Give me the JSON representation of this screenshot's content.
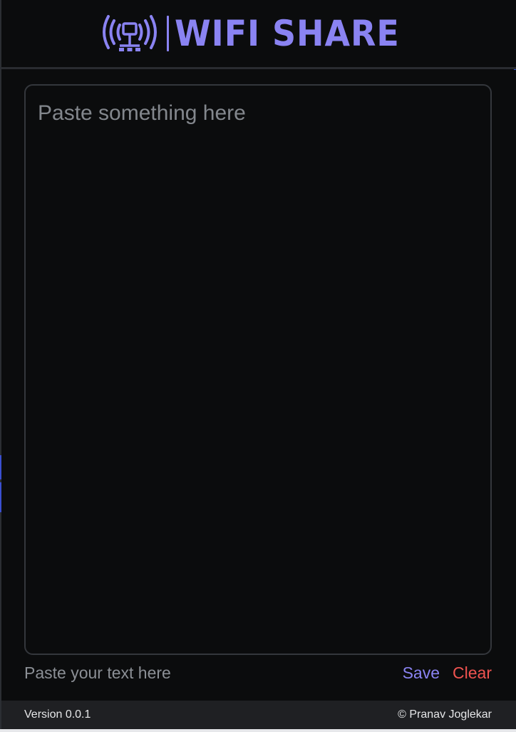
{
  "header": {
    "brand": "WIFI SHARE",
    "logo_icon": "wifi-broadcast-network-icon",
    "brand_color": "#8a83f2"
  },
  "editor": {
    "placeholder": "Paste something here",
    "value": ""
  },
  "action_bar": {
    "hint": "Paste your text here",
    "save_label": "Save",
    "clear_label": "Clear",
    "save_color": "#8a83f2",
    "clear_color": "#ef5350"
  },
  "footer": {
    "version": "Version 0.0.1",
    "copyright": "© Pranav Joglekar"
  }
}
